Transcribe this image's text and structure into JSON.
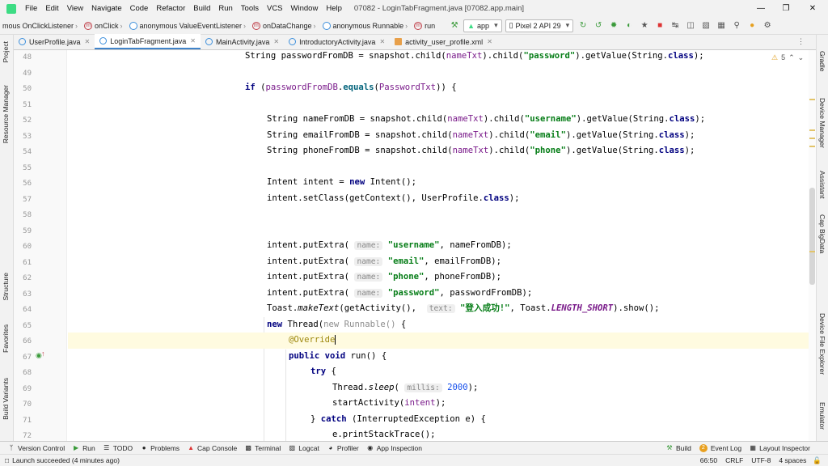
{
  "menu": {
    "items": [
      "File",
      "Edit",
      "View",
      "Navigate",
      "Code",
      "Refactor",
      "Build",
      "Run",
      "Tools",
      "VCS",
      "Window",
      "Help"
    ],
    "window_title": "07082 - LoginTabFragment.java [07082.app.main]"
  },
  "breadcrumbs": [
    "mous OnClickListener",
    "onClick",
    "anonymous ValueEventListener",
    "onDataChange",
    "anonymous Runnable",
    "run"
  ],
  "toolbar": {
    "run_config": "app",
    "device": "Pixel 2 API 29"
  },
  "left_panels": [
    "Project",
    "Resource Manager",
    "Structure",
    "Favorites",
    "Build Variants"
  ],
  "right_panels": [
    "Gradle",
    "Device Manager",
    "Assistant",
    "Cap BigData",
    "Device File Explorer",
    "Emulator"
  ],
  "tabs": [
    {
      "label": "UserProfile.java",
      "active": false
    },
    {
      "label": "LoginTabFragment.java",
      "active": true
    },
    {
      "label": "MainActivity.java",
      "active": false
    },
    {
      "label": "IntroductoryActivity.java",
      "active": false
    },
    {
      "label": "activity_user_profile.xml",
      "active": false
    }
  ],
  "line_numbers": [
    "48",
    "49",
    "50",
    "51",
    "52",
    "53",
    "54",
    "55",
    "56",
    "57",
    "58",
    "59",
    "60",
    "61",
    "62",
    "63",
    "64",
    "65",
    "66",
    "67",
    "68",
    "69",
    "70",
    "71",
    "72"
  ],
  "code": {
    "l48": "String passwordFromDB = snapshot.child(nameTxt).child(\"password\").getValue(String.class);",
    "l50": "if (passwordFromDB.equals(PasswordTxt)) {",
    "l52": "String nameFromDB = snapshot.child(nameTxt).child(\"username\").getValue(String.class);",
    "l53": "String emailFromDB = snapshot.child(nameTxt).child(\"email\").getValue(String.class);",
    "l54": "String phoneFromDB = snapshot.child(nameTxt).child(\"phone\").getValue(String.class);",
    "l56": "Intent intent = new Intent();",
    "l57": "intent.setClass(getContext(), UserProfile.class);",
    "l60": "intent.putExtra( name: \"username\", nameFromDB);",
    "l61": "intent.putExtra( name: \"email\", emailFromDB);",
    "l62": "intent.putExtra( name: \"phone\", phoneFromDB);",
    "l63": "intent.putExtra( name: \"password\", passwordFromDB);",
    "l64": "Toast.makeText(getActivity(),  text: \"登入成功!\", Toast.LENGTH_SHORT).show();",
    "l65": "new Thread(new Runnable() {",
    "l66": "@Override",
    "l67": "public void run() {",
    "l68": "try {",
    "l69": "Thread.sleep( millis: 2000);",
    "l70": "startActivity(intent);",
    "l71": "} catch (InterruptedException e) {",
    "l72": "e.printStackTrace();"
  },
  "inspection": {
    "warnings": "5"
  },
  "tool_windows": [
    "Version Control",
    "Run",
    "TODO",
    "Problems",
    "Cap Console",
    "Terminal",
    "Logcat",
    "Profiler",
    "App Inspection"
  ],
  "tool_windows_right": [
    "Build",
    "Event Log",
    "Layout Inspector"
  ],
  "event_log_count": "2",
  "status": {
    "message": "Launch succeeded (4 minutes ago)",
    "position": "66:50",
    "line_sep": "CRLF",
    "encoding": "UTF-8",
    "indent": "4 spaces"
  }
}
